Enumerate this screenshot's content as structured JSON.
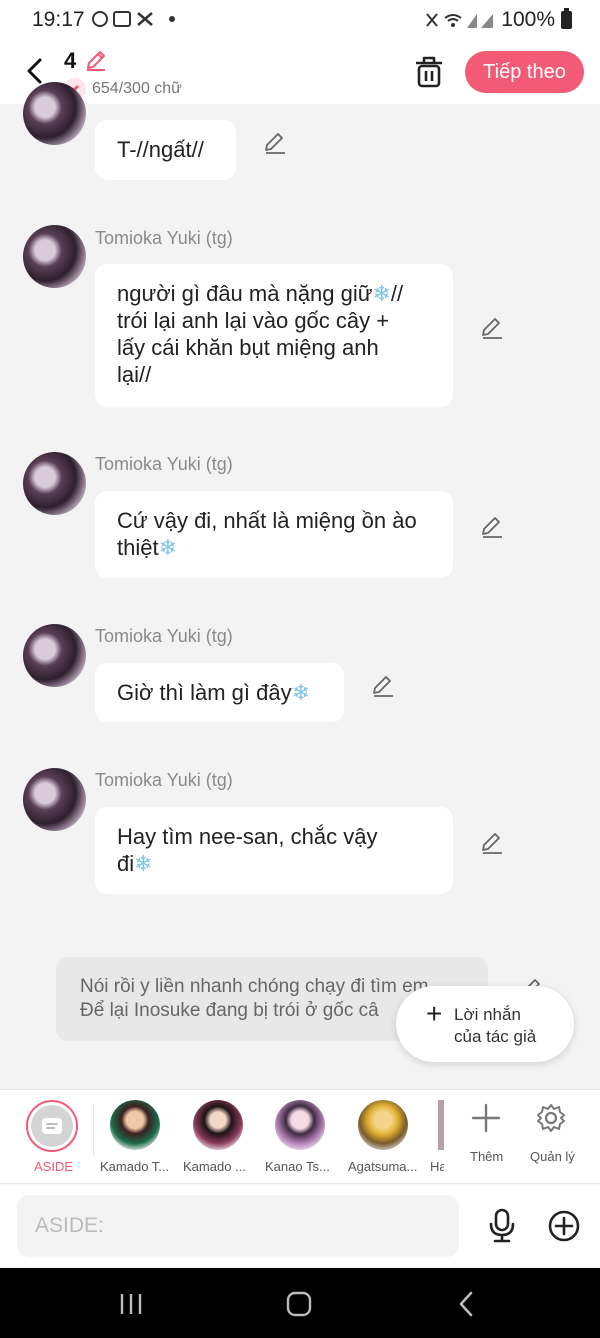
{
  "status_bar": {
    "time": "19:17",
    "battery": "100%"
  },
  "header": {
    "part_number": "4",
    "word_count": "654/300 chữ",
    "next_label": "Tiếp theo"
  },
  "messages": [
    {
      "text": "T-//ngất//",
      "show_name": false
    },
    {
      "author": "Tomioka Yuki (tg)",
      "line1": "người gì đâu mà nặng giữ",
      "line1b": "//",
      "line2": "trói lại anh lại vào gốc cây +",
      "line3": "lấy cái khăn bụt miệng anh",
      "line4": "lại//"
    },
    {
      "author": "Tomioka Yuki (tg)",
      "line1": "Cứ vậy đi, nhất là miệng ồn ào",
      "line2": "thiệt"
    },
    {
      "author": "Tomioka Yuki (tg)",
      "line1": "Giờ thì làm gì đây"
    },
    {
      "author": "Tomioka Yuki (tg)",
      "line1": "Hay tìm nee-san, chắc vậy",
      "line2": "đi"
    }
  ],
  "narration": {
    "line1": "Nói rồi y liền nhanh chóng chạy đi tìm em",
    "line2": "Để lại Inosuke đang bị trói ở gốc câ"
  },
  "author_note": {
    "line1": "Lời nhắn",
    "line2": "của tác giả"
  },
  "characters": {
    "aside_label": "ASIDE",
    "list": [
      "Kamado T...",
      "Kamado ...",
      "Kanao Ts...",
      "Agatsuma...",
      "Ha"
    ],
    "add_label": "Thêm",
    "manage_label": "Quản lý"
  },
  "input": {
    "placeholder": "ASIDE:"
  },
  "colors": {
    "accent": "#f25a75",
    "background": "#f3f3f3",
    "bubble": "#ffffff"
  },
  "icons": [
    "back-arrow-icon",
    "pencil-icon",
    "trash-icon",
    "edit-icon",
    "snowflake-icon",
    "plus-icon",
    "gear-icon",
    "microphone-icon",
    "add-circle-icon",
    "recent-apps-icon",
    "home-icon",
    "nav-back-icon"
  ]
}
